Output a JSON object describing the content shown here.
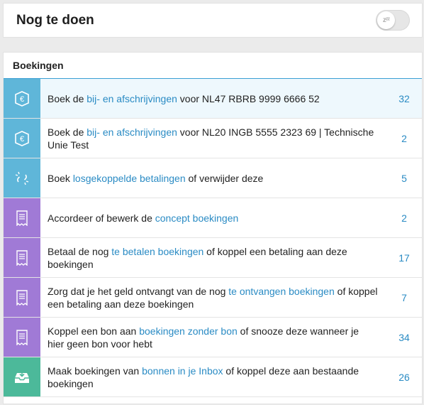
{
  "header": {
    "title": "Nog te doen",
    "snooze_glyph": "zᶻᶻ"
  },
  "section": {
    "title": "Boekingen"
  },
  "colors": {
    "bank": "#5fb6d9",
    "unlinked": "#5fb6d9",
    "booking": "#a07ad6",
    "inbox": "#4cb99a",
    "link": "#2a8bc4"
  },
  "rows": [
    {
      "icon": "euro-bank-icon",
      "kind": "bank",
      "before": "Boek de ",
      "link": "bij- en afschrijvingen",
      "after": " voor NL47 RBRB 9999 6666 52",
      "count": "32"
    },
    {
      "icon": "euro-bank-icon",
      "kind": "bank",
      "before": "Boek de ",
      "link": "bij- en afschrijvingen",
      "after": " voor NL20 INGB 5555 2323 69 | Technische Unie Test",
      "count": "2"
    },
    {
      "icon": "unlink-icon",
      "kind": "unlinked",
      "before": "Boek ",
      "link": "losgekoppelde betalingen",
      "after": " of verwijder deze",
      "count": "5"
    },
    {
      "icon": "receipt-icon",
      "kind": "booking",
      "before": "Accordeer of bewerk de ",
      "link": "concept boekingen",
      "after": "",
      "count": "2"
    },
    {
      "icon": "receipt-icon",
      "kind": "booking",
      "before": "Betaal de nog ",
      "link": "te betalen boekingen",
      "after": " of koppel een betaling aan deze boekingen",
      "count": "17"
    },
    {
      "icon": "receipt-icon",
      "kind": "booking",
      "before": "Zorg dat je het geld ontvangt van de nog ",
      "link": "te ontvangen boekingen",
      "after": " of koppel een betaling aan deze boekingen",
      "count": "7"
    },
    {
      "icon": "receipt-icon",
      "kind": "booking",
      "before": "Koppel een bon aan ",
      "link": "boekingen zonder bon",
      "after": " of snooze deze wanneer je hier geen bon voor hebt",
      "count": "34"
    },
    {
      "icon": "inbox-icon",
      "kind": "inbox",
      "before": "Maak boekingen van ",
      "link": "bonnen in je Inbox",
      "after": " of koppel deze aan bestaande boekingen",
      "count": "26"
    }
  ]
}
